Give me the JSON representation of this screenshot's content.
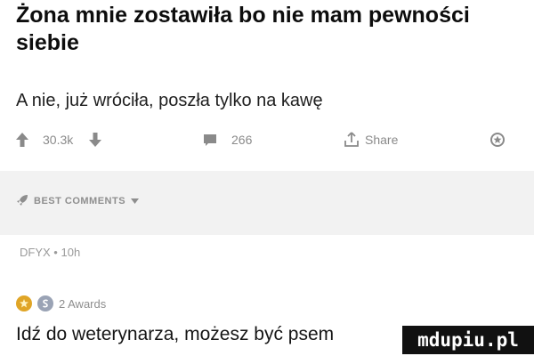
{
  "post": {
    "title": "Żona mnie zostawiła bo nie mam pewności siebie",
    "body": "A nie, już wróciła, poszła tylko na kawę"
  },
  "actions": {
    "upvotes": "30.3k",
    "comments": "266",
    "share_label": "Share"
  },
  "comments_section": {
    "sort_label": "BEST COMMENTS"
  },
  "comment": {
    "author": "DFYX",
    "separator": "•",
    "age": "10h",
    "awards_label": "2 Awards",
    "text": "Idź do weterynarza, możesz być psem"
  },
  "watermark": {
    "text": "mdupiu.pl"
  },
  "colors": {
    "icon_gray": "#8a8a8a",
    "band_gray": "#f2f2f2",
    "award_gold": "#e0a526",
    "award_silver": "#9aa3b5"
  }
}
